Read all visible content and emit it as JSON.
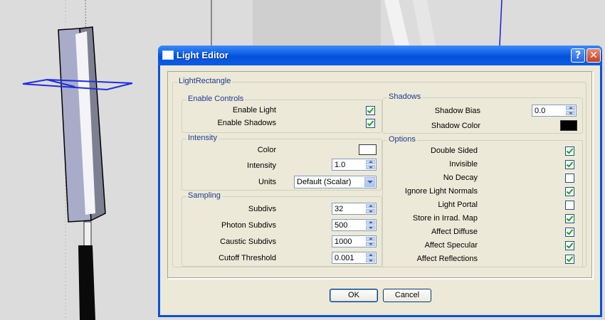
{
  "window": {
    "title": "Light Editor",
    "help_symbol": "?",
    "close_symbol": "✕"
  },
  "main_group": {
    "label": "LightRectangle"
  },
  "enable_controls": {
    "label": "Enable Controls",
    "items": [
      {
        "label": "Enable Light",
        "checked": true
      },
      {
        "label": "Enable Shadows",
        "checked": true
      }
    ]
  },
  "intensity": {
    "label": "Intensity",
    "color_label": "Color",
    "color_value": "#ffffff",
    "intensity_label": "Intensity",
    "intensity_value": "1.0",
    "units_label": "Units",
    "units_value": "Default (Scalar)"
  },
  "sampling": {
    "label": "Sampling",
    "items": [
      {
        "label": "Subdivs",
        "value": "32"
      },
      {
        "label": "Photon Subdivs",
        "value": "500"
      },
      {
        "label": "Caustic Subdivs",
        "value": "1000"
      },
      {
        "label": "Cutoff Threshold",
        "value": "0.001"
      }
    ]
  },
  "shadows": {
    "label": "Shadows",
    "bias_label": "Shadow Bias",
    "bias_value": "0.0",
    "color_label": "Shadow Color",
    "color_value": "#000000"
  },
  "options": {
    "label": "Options",
    "items": [
      {
        "label": "Double Sided",
        "checked": true
      },
      {
        "label": "Invisible",
        "checked": true
      },
      {
        "label": "No Decay",
        "checked": false
      },
      {
        "label": "Ignore Light Normals",
        "checked": true
      },
      {
        "label": "Light Portal",
        "checked": false
      },
      {
        "label": "Store in Irrad. Map",
        "checked": true
      },
      {
        "label": "Affect Diffuse",
        "checked": true
      },
      {
        "label": "Affect Specular",
        "checked": true
      },
      {
        "label": "Affect Reflections",
        "checked": true
      }
    ]
  },
  "buttons": {
    "ok": "OK",
    "cancel": "Cancel"
  },
  "colors": {
    "title_bar": "#0a5ce6",
    "dialog_face": "#ece9d8",
    "group_label": "#1e3a8e",
    "check": "#21a121"
  }
}
